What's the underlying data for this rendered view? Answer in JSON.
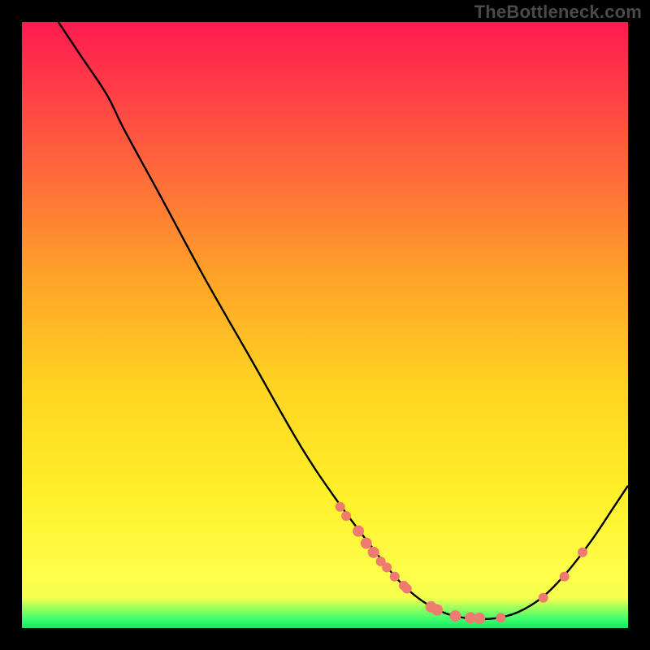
{
  "watermark": "TheBottleneck.com",
  "colors": {
    "frame_bg": "#000000",
    "marker_fill": "#ee7b6f",
    "curve_stroke": "#000000"
  },
  "chart_data": {
    "type": "line",
    "title": "",
    "xlabel": "",
    "ylabel": "",
    "xlim": [
      0,
      100
    ],
    "ylim": [
      0,
      100
    ],
    "curve_points": [
      {
        "x": 6,
        "y": 100
      },
      {
        "x": 10,
        "y": 94
      },
      {
        "x": 14,
        "y": 88
      },
      {
        "x": 17,
        "y": 82
      },
      {
        "x": 23,
        "y": 71
      },
      {
        "x": 30,
        "y": 58
      },
      {
        "x": 38,
        "y": 44
      },
      {
        "x": 46,
        "y": 30
      },
      {
        "x": 52,
        "y": 21
      },
      {
        "x": 58,
        "y": 13
      },
      {
        "x": 62,
        "y": 8
      },
      {
        "x": 66,
        "y": 4.5
      },
      {
        "x": 70,
        "y": 2.4
      },
      {
        "x": 74,
        "y": 1.6
      },
      {
        "x": 78,
        "y": 1.6
      },
      {
        "x": 82,
        "y": 2.7
      },
      {
        "x": 86,
        "y": 5.2
      },
      {
        "x": 90,
        "y": 9.3
      },
      {
        "x": 94,
        "y": 14.5
      },
      {
        "x": 98,
        "y": 20.5
      },
      {
        "x": 100,
        "y": 23.5
      }
    ],
    "markers": [
      {
        "x": 52.5,
        "y": 20,
        "r": 6
      },
      {
        "x": 53.5,
        "y": 18.5,
        "r": 6
      },
      {
        "x": 55.5,
        "y": 16,
        "r": 7
      },
      {
        "x": 56.8,
        "y": 14,
        "r": 7
      },
      {
        "x": 58,
        "y": 12.5,
        "r": 7
      },
      {
        "x": 59.2,
        "y": 11,
        "r": 6
      },
      {
        "x": 60.2,
        "y": 10,
        "r": 6
      },
      {
        "x": 61.5,
        "y": 8.5,
        "r": 6
      },
      {
        "x": 63,
        "y": 7,
        "r": 6
      },
      {
        "x": 63.5,
        "y": 6.5,
        "r": 6
      },
      {
        "x": 67.5,
        "y": 3.5,
        "r": 7
      },
      {
        "x": 68.5,
        "y": 3,
        "r": 7
      },
      {
        "x": 71.5,
        "y": 2,
        "r": 7
      },
      {
        "x": 74,
        "y": 1.7,
        "r": 7
      },
      {
        "x": 75.5,
        "y": 1.6,
        "r": 7
      },
      {
        "x": 79,
        "y": 1.7,
        "r": 6
      },
      {
        "x": 86,
        "y": 5,
        "r": 6
      },
      {
        "x": 89.5,
        "y": 8.5,
        "r": 6
      },
      {
        "x": 92.5,
        "y": 12.5,
        "r": 6
      }
    ]
  }
}
